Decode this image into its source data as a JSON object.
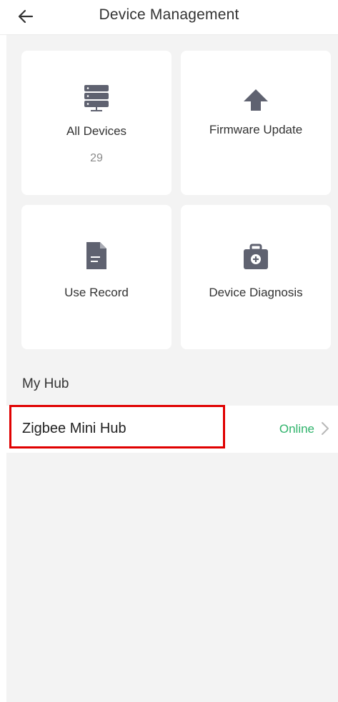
{
  "header": {
    "title": "Device Management",
    "back_icon": "arrow-left-icon"
  },
  "cards": [
    {
      "label": "All Devices",
      "count": "29",
      "icon": "server-stack-icon"
    },
    {
      "label": "Firmware Update",
      "icon": "upload-arrow-icon"
    },
    {
      "label": "Use Record",
      "icon": "document-icon"
    },
    {
      "label": "Device Diagnosis",
      "icon": "medical-kit-icon"
    }
  ],
  "hub_section": {
    "title": "My Hub",
    "items": [
      {
        "name": "Zigbee Mini Hub",
        "status": "Online",
        "status_color": "#2fb36b"
      }
    ]
  },
  "colors": {
    "background": "#f3f3f3",
    "card": "#ffffff",
    "icon": "#5f6270",
    "highlight": "#e00000"
  }
}
